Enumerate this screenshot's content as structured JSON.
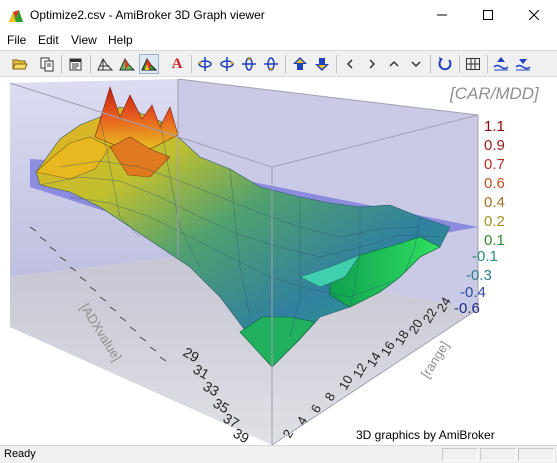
{
  "window": {
    "title": "Optimize2.csv - AmiBroker 3D Graph viewer",
    "minimize_glyph": "–",
    "maximize_glyph": "☐",
    "close_glyph": "✕"
  },
  "menu": {
    "items": [
      {
        "label": "File"
      },
      {
        "label": "Edit"
      },
      {
        "label": "View"
      },
      {
        "label": "Help"
      }
    ]
  },
  "toolbar": {
    "buttons": [
      {
        "icon": "open-folder-icon"
      },
      {
        "icon": "copy-icon"
      },
      {
        "icon": "properties-icon"
      },
      {
        "icon": "wireframe-mode-icon"
      },
      {
        "icon": "shaded-mode-icon"
      },
      {
        "icon": "solid-mode-icon",
        "pressed": true
      },
      {
        "icon": "labels-icon",
        "glyph": "A"
      },
      {
        "icon": "rotate-left-icon"
      },
      {
        "icon": "rotate-right-icon"
      },
      {
        "icon": "rotate-up-icon"
      },
      {
        "icon": "rotate-down-icon"
      },
      {
        "icon": "zoom-in-icon"
      },
      {
        "icon": "zoom-out-icon"
      },
      {
        "icon": "move-left-icon"
      },
      {
        "icon": "move-right-icon"
      },
      {
        "icon": "move-up-icon"
      },
      {
        "icon": "move-down-icon"
      },
      {
        "icon": "reset-view-icon"
      },
      {
        "icon": "grid-icon"
      },
      {
        "icon": "plane-up-icon"
      },
      {
        "icon": "plane-down-icon"
      }
    ]
  },
  "graph": {
    "z_axis_title": "[CAR/MDD]",
    "z_ticks": [
      "1.1",
      "0.9",
      "0.7",
      "0.6",
      "0.4",
      "0.2",
      "0.1",
      "-0.1",
      "-0.3",
      "-0.4",
      "-0.6"
    ],
    "z_tick_colors": [
      "#8b0000",
      "#9b1a1a",
      "#b03020",
      "#c05020",
      "#b07020",
      "#a09020",
      "#2e8b2e",
      "#2e8b6e",
      "#2e7b8b",
      "#2a4a9b",
      "#1a2a8b"
    ],
    "x_axis_title": "[ADXvalue]",
    "x_ticks_visible": [
      "29",
      "31",
      "33",
      "35",
      "37",
      "39"
    ],
    "y_axis_title": "[range]",
    "y_ticks_visible": [
      "2",
      "4",
      "6",
      "8",
      "10",
      "12",
      "14",
      "16",
      "18",
      "20",
      "22",
      "24"
    ],
    "credit": "3D graphics by AmiBroker",
    "plane_color": "#5a5ad8",
    "surface_high_color": "#d83010",
    "surface_low_color": "#10c060"
  },
  "status": {
    "text": "Ready"
  }
}
